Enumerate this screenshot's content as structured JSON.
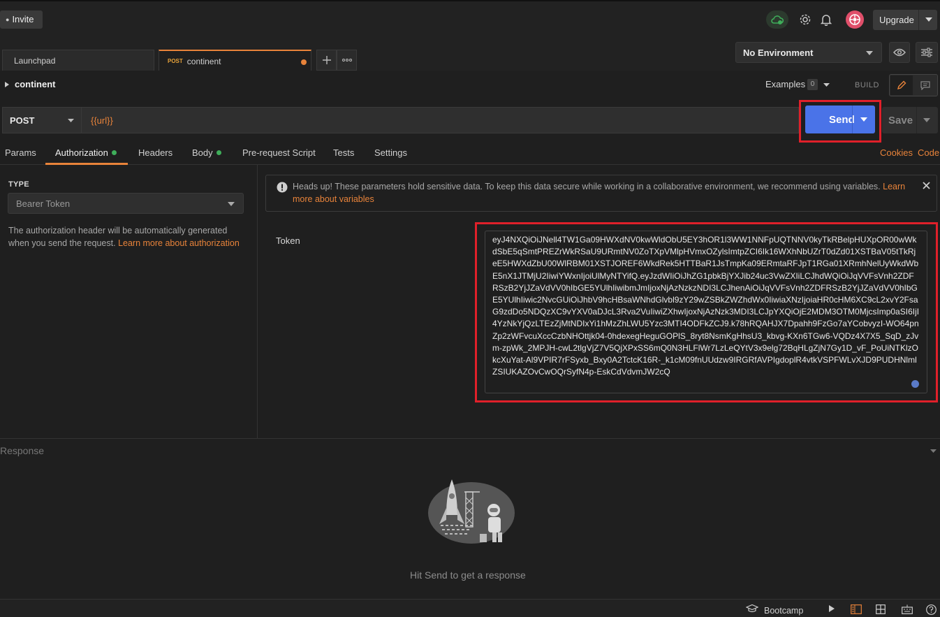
{
  "topbar": {
    "invite_label": "Invite",
    "upgrade_label": "Upgrade"
  },
  "tabs": {
    "launchpad_label": "Launchpad",
    "active_tab": {
      "method": "POST",
      "label": "continent"
    }
  },
  "environment": {
    "selected": "No Environment"
  },
  "request": {
    "name": "continent",
    "examples_label": "Examples",
    "examples_count": "0",
    "build_label": "BUILD",
    "method": "POST",
    "url": "{{url}}",
    "send_label": "Send",
    "save_label": "Save"
  },
  "request_tabs": {
    "params": "Params",
    "authorization": "Authorization",
    "headers": "Headers",
    "body": "Body",
    "pre_request": "Pre-request Script",
    "tests": "Tests",
    "settings": "Settings",
    "cookies": "Cookies",
    "code": "Code"
  },
  "auth": {
    "type_label": "TYPE",
    "type_value": "Bearer Token",
    "description": "The authorization header will be automatically generated when you send the request. ",
    "description_link": "Learn more about authorization",
    "alert_text": "Heads up! These parameters hold sensitive data. To keep this data secure while working in a collaborative environment, we recommend using variables. ",
    "alert_link": "Learn more about variables",
    "token_label": "Token",
    "token_value": "eyJ4NXQiOiJNell4TW1Ga09HWXdNV0kwWldObU5EY3hOR1l3WW1NNFpUQTNNV0kyTkRBelpHUXpOR00wWkdSbE5qSmtPREZrWkRSaU9URmtNV0ZoTXpVMlpHVmxOZylsImtpZCI6Ik16WXhNbUZrT0dZd01XSTBaV05tTkRjeE5HWXdZbU00WlRBM01XSTJOREF6WkdRek5HTTBaR1JsTmpKa09ERmtaRFJpT1RGa01XRmhNelUyWkdWbE5nX1JTMjU2IiwiYWxnIjoiUlMyNTYifQ.eyJzdWIiOiJhZG1pbkBjYXJib24uc3VwZXIiLCJhdWQiOiJqVVFsVnh2ZDFRSzB2YjJZaVdVV0hIbGE5YUlhIiwibmJmIjoxNjAzNzkzNDI3LCJhenAiOiJqVVFsVnh2ZDFRSzB2YjJZaVdVV0hIbGE5YUlhIiwic2NvcGUiOiJhbV9hcHBsaWNhdGlvbl9zY29wZSBkZWZhdWx0IiwiaXNzIjoiaHR0cHM6XC9cL2xvY2FsaG9zdDo5NDQzXC9vYXV0aDJcL3Rva2VuIiwiZXhwIjoxNjAzNzk3MDI3LCJpYXQiOjE2MDM3OTM0MjcsImp0aSI6IjI4YzNkYjQzLTEzZjMtNDIxYi1hMzZhLWU5Yzc3MTI4ODFkZCJ9.k78hRQAHJX7Dpahh9FzGo7aYCobvyzI-WO64pnZp2zWFvcuXccCzbNHOttjk04-0hdexegHeguGOPlS_8ryt8NsmKgHhsU3_kbvg-KXn6TGw6-VQDz4X7X5_SqD_zJvm-zpWk_2MPJH-cwL2tlgVjZ7V5QjXPxSS6mQ0N3HLFlWr7LzLeQYtV3x9elg72BqHLgZjN7Gy1D_vF_PoUiNTKlzOkcXuYat-Al9VPIR7rFSyxb_Bxy0A2TctcK16R-_k1cM09fnUUdzw9IRGRfAVPIgdoplR4vtkVSPFWLvXJD9PUDHNlmlZSIUKAZOvCwOQrSyfN4p-EskCdVdvmJW2cQ"
  },
  "response": {
    "label": "Response",
    "hint": "Hit Send to get a response"
  },
  "statusbar": {
    "bootcamp_label": "Bootcamp"
  },
  "colors": {
    "accent": "#e8833a",
    "send": "#4a73e8",
    "highlight": "#e0202a",
    "success": "#3fae5a"
  }
}
